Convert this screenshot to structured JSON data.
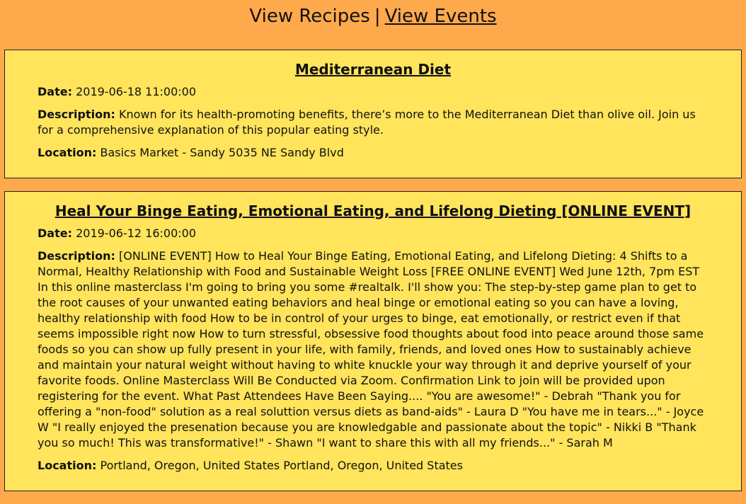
{
  "nav": {
    "recipes_label": "View Recipes",
    "separator": "|",
    "events_label": "View Events"
  },
  "labels": {
    "date": "Date:",
    "description": "Description:",
    "location": "Location:"
  },
  "events": [
    {
      "title": "Mediterranean Diet",
      "date": "2019-06-18 11:00:00",
      "description": "Known for its health-promoting benefits, there’s more to the Mediterranean Diet than olive oil. Join us for a comprehensive explanation of this popular eating style.",
      "location": "Basics Market - Sandy 5035 NE Sandy Blvd"
    },
    {
      "title": "Heal Your Binge Eating, Emotional Eating, and Lifelong Dieting [ONLINE EVENT]",
      "date": "2019-06-12 16:00:00",
      "description": "[ONLINE EVENT] How to Heal Your Binge Eating, Emotional Eating, and Lifelong Dieting: 4 Shifts to a Normal, Healthy Relationship with Food and Sustainable Weight Loss [FREE ONLINE EVENT] Wed June 12th, 7pm EST In this online masterclass I'm going to bring you some #realtalk. I'll show you: The step-by-step game plan to get to the root causes of your unwanted eating behaviors and heal binge or emotional eating so you can have a loving, healthy relationship with food How to be in control of your urges to binge, eat emotionally, or restrict even if that seems impossible right now How to turn stressful, obsessive food thoughts about food into peace around those same foods so you can show up fully present in your life, with family, friends, and loved ones How to sustainably achieve and maintain your natural weight without having to white knuckle your way through it and deprive yourself of your favorite foods. Online Masterclass Will Be Conducted via Zoom. Confirmation Link to join will be provided upon registering for the event. What Past Attendees Have Been Saying.... \"You are awesome!\" - Debrah \"Thank you for offering a \"non-food\" solution as a real soluttion versus diets as band-aids\" - Laura D \"You have me in tears...\" - Joyce W \"I really enjoyed the presenation because you are knowledgable and passionate about the topic\" - Nikki B \"Thank you so much! This was transformative!\" - Shawn \"I want to share this with all my friends...\" - Sarah M",
      "location": "Portland, Oregon, United States Portland, Oregon, United States"
    }
  ],
  "colors": {
    "page_background": "#ffa94d",
    "card_background": "#ffe45c",
    "border": "#222222"
  }
}
